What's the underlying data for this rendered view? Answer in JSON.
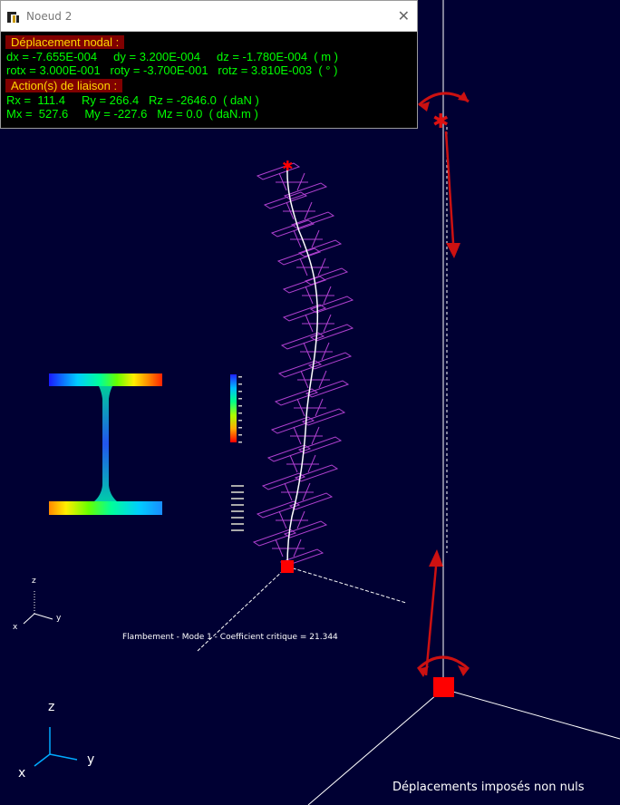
{
  "window": {
    "title": "Noeud 2",
    "close_glyph": "✕",
    "icon": "app-logo-icon",
    "sections": {
      "displacement": {
        "header": "Déplacement nodal :",
        "line1": "dx = -7.655E-004     dy = 3.200E-004     dz = -1.780E-004  ( m )",
        "line2": "rotx = 3.000E-001   roty = -3.700E-001   rotz = 3.810E-003  ( ° )"
      },
      "reactions": {
        "header": "Action(s) de liaison :",
        "line1": "Rx =  111.4     Ry = 266.4   Rz = -2646.0  ( daN )",
        "line2": "Mx =  527.6     My = -227.6   Mz = 0.0  ( daN.m )"
      }
    }
  },
  "viewport": {
    "caption": "Flambement - Mode 1 - Coefficient critique = 21.344",
    "bottom_label": "Déplacements imposés non nuls",
    "axes_small": {
      "x": "x",
      "y": "y",
      "z": "z"
    },
    "axes_large": {
      "x": "x",
      "y": "y",
      "z": "z"
    }
  },
  "colors": {
    "background": "#000033",
    "beam": "#ffffff",
    "section": "#b040d0",
    "support": "#ff0000",
    "arrow": "#cc1111",
    "panel_text": "#00ff00",
    "panel_header_bg": "#800000",
    "panel_header_text": "#ffd700"
  }
}
